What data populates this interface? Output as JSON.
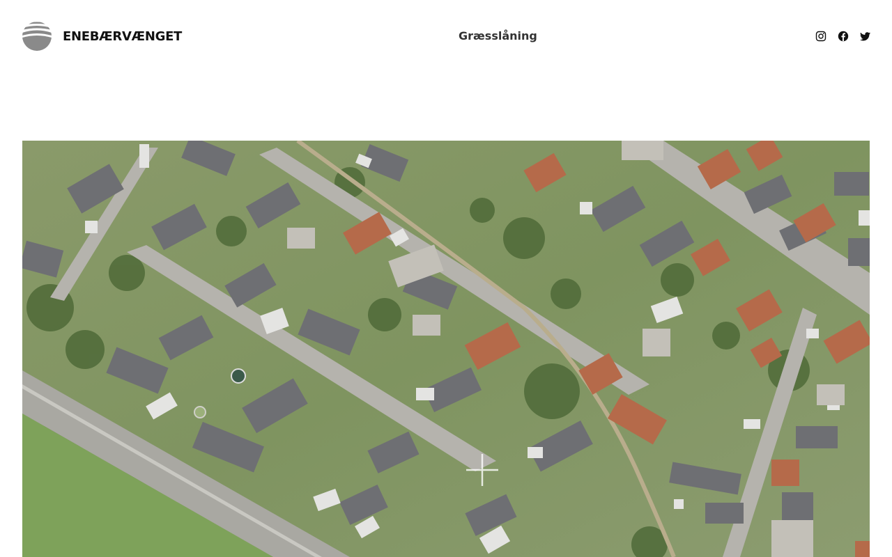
{
  "site": {
    "title": "ENEBÆRVÆNGET"
  },
  "nav": {
    "items": [
      {
        "label": "Græsslåning"
      }
    ]
  },
  "social": [
    {
      "icon": "instagram-icon"
    },
    {
      "icon": "facebook-icon"
    },
    {
      "icon": "twitter-icon"
    }
  ],
  "colors": {
    "text": "#111111",
    "nav_text": "#333333",
    "logo": "#8a8a8a",
    "background": "#ffffff"
  }
}
